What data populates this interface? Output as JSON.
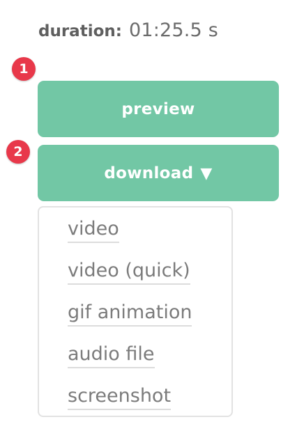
{
  "duration": {
    "label": "duration:",
    "value": "01:25.5 s"
  },
  "badges": [
    "1",
    "2"
  ],
  "buttons": {
    "preview_label": "preview",
    "download_label": "download",
    "download_caret": "▼"
  },
  "download_menu": {
    "items": [
      {
        "label": "video"
      },
      {
        "label": "video (quick)"
      },
      {
        "label": "gif animation"
      },
      {
        "label": "audio file"
      },
      {
        "label": "screenshot"
      }
    ]
  },
  "colors": {
    "button_green": "#72c7a5",
    "badge_red": "#e8384a",
    "text_gray": "#7b7b7b"
  },
  "icons": {
    "download_caret": "triangle-down-icon"
  }
}
